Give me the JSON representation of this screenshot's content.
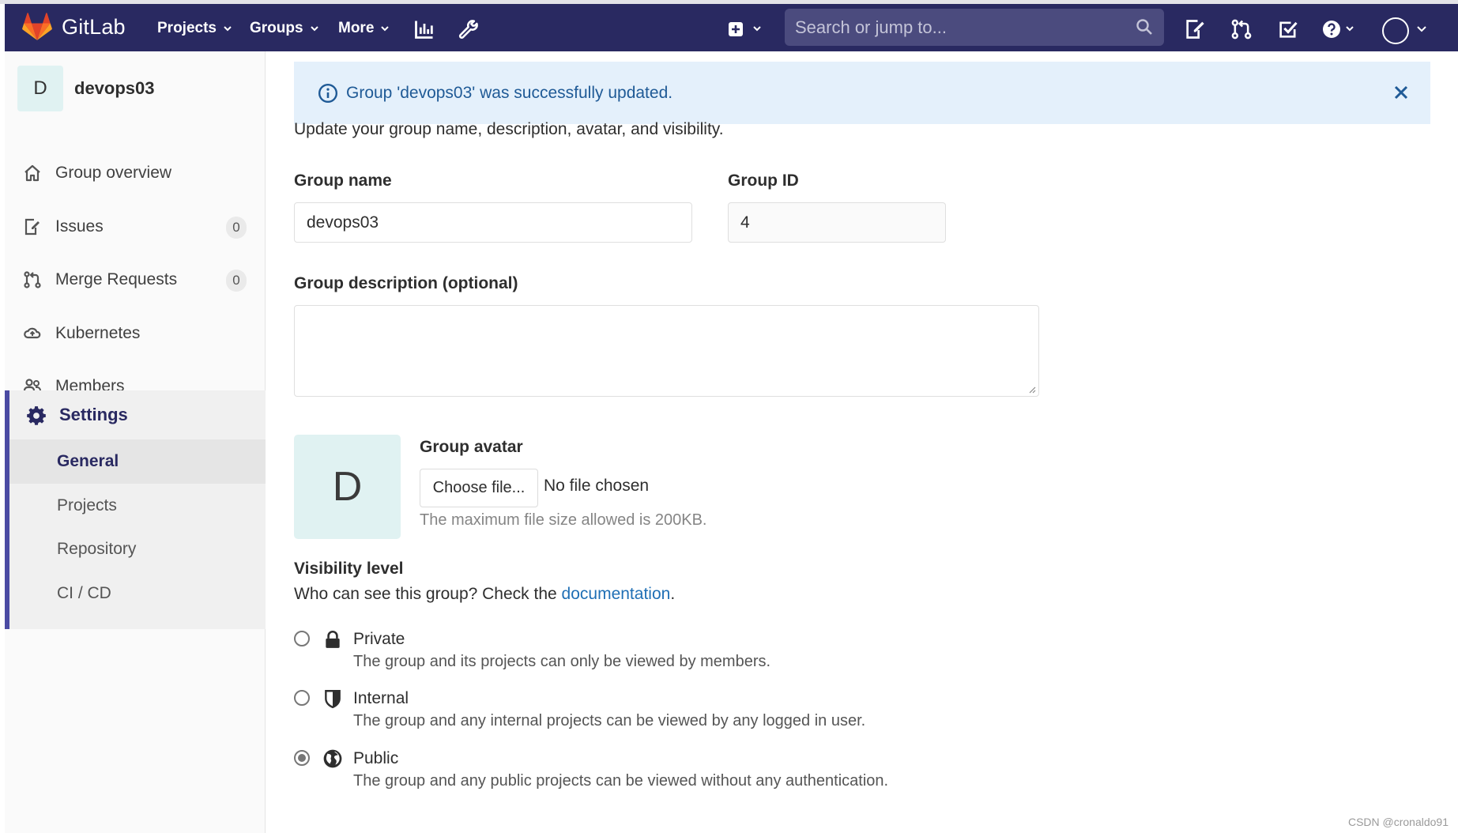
{
  "navbar": {
    "brand": "GitLab",
    "projects": "Projects",
    "groups": "Groups",
    "more": "More",
    "search_placeholder": "Search or jump to..."
  },
  "sidebar": {
    "group_initial": "D",
    "group_name": "devops03",
    "items": [
      {
        "label": "Group overview",
        "icon": "home-icon"
      },
      {
        "label": "Issues",
        "icon": "issues-icon",
        "count": "0"
      },
      {
        "label": "Merge Requests",
        "icon": "merge-request-icon",
        "count": "0"
      },
      {
        "label": "Kubernetes",
        "icon": "kubernetes-icon"
      },
      {
        "label": "Members",
        "icon": "members-icon"
      }
    ],
    "settings": {
      "label": "Settings",
      "sub_items": [
        "General",
        "Projects",
        "Repository",
        "CI / CD"
      ],
      "active": "General"
    }
  },
  "flash": {
    "message": "Group 'devops03' was successfully updated."
  },
  "form": {
    "lead": "Update your group name, description, avatar, and visibility.",
    "group_name_label": "Group name",
    "group_name_value": "devops03",
    "group_id_label": "Group ID",
    "group_id_value": "4",
    "description_label": "Group description (optional)",
    "description_value": "",
    "avatar_initial": "D",
    "avatar_label": "Group avatar",
    "choose_file": "Choose file...",
    "no_file": "No file chosen",
    "max_size": "The maximum file size allowed is 200KB.",
    "visibility_label": "Visibility level",
    "visibility_help": "Who can see this group? Check the",
    "visibility_link": "documentation",
    "visibility_options": [
      {
        "title": "Private",
        "desc": "The group and its projects can only be viewed by members.",
        "checked": false,
        "icon": "lock-icon"
      },
      {
        "title": "Internal",
        "desc": "The group and any internal projects can be viewed by any logged in user.",
        "checked": false,
        "icon": "shield-icon"
      },
      {
        "title": "Public",
        "desc": "The group and any public projects can be viewed without any authentication.",
        "checked": true,
        "icon": "globe-icon"
      }
    ]
  },
  "watermark": "CSDN @cronaldo91",
  "colors": {
    "navbar": "#292961",
    "accent": "#4b4ba3",
    "flash_bg": "#e4f0fb",
    "link": "#1f6fb5"
  }
}
